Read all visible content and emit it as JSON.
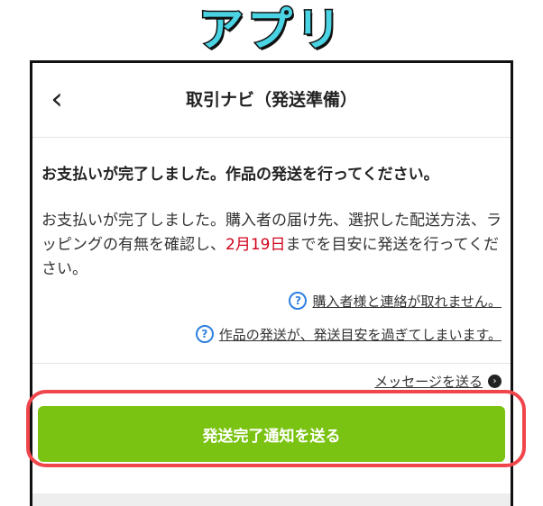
{
  "badge_label": "アプリ",
  "header": {
    "back_icon": "chevron-left-icon",
    "title": "取引ナビ（発送準備）"
  },
  "main": {
    "heading": "お支払いが完了しました。作品の発送を行ってください。",
    "body_before": "お支払いが完了しました。購入者の届け先、選択した配送方法、ラッピングの有無を確認し、",
    "deadline": "2月19日",
    "body_after": "までを目安に発送を行ってください。",
    "help_links": [
      {
        "icon": "question-circle-icon",
        "label": "購入者様と連絡が取れません。"
      },
      {
        "icon": "question-circle-icon",
        "label": "作品の発送が、発送目安を過ぎてしまいます。"
      }
    ],
    "message_link": "メッセージを送る",
    "cta_label": "発送完了通知を送る"
  },
  "colors": {
    "badge": "#4ad3e3",
    "accent_green": "#7ac312",
    "deadline_red": "#d0021b",
    "help_icon_blue": "#2f7fe0",
    "highlight_outline": "#f0454b"
  }
}
